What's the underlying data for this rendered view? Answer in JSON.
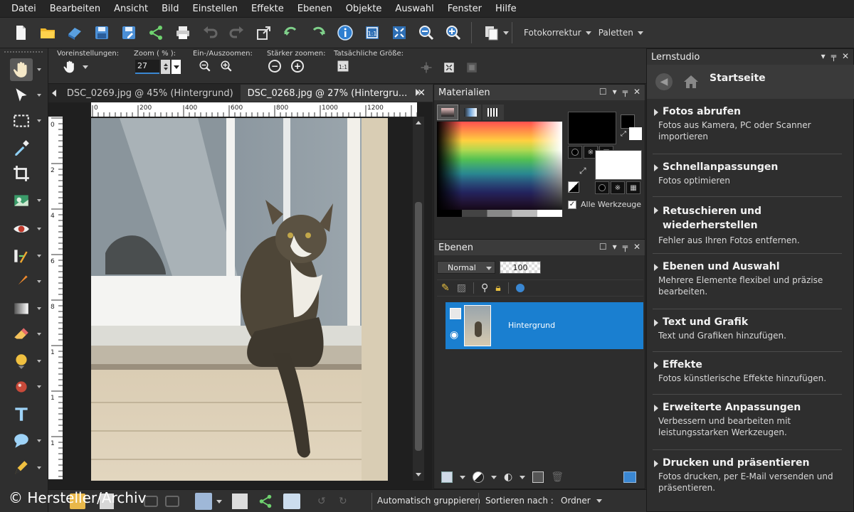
{
  "menubar": {
    "items": [
      "Datei",
      "Bearbeiten",
      "Ansicht",
      "Bild",
      "Einstellen",
      "Effekte",
      "Ebenen",
      "Objekte",
      "Auswahl",
      "Fenster",
      "Hilfe"
    ]
  },
  "toolbar": {
    "fotokorrektur_label": "Fotokorrektur",
    "paletten_label": "Paletten"
  },
  "tool_options": {
    "presets_label": "Voreinstellungen:",
    "zoom_label": "Zoom ( % ):",
    "zoom_value": "27",
    "zoom_in_out_label": "Ein-/Auszoomen:",
    "zoom_more_label": "Stärker zoomen:",
    "actual_size_label": "Tatsächliche Größe:"
  },
  "documents": {
    "tabs": [
      {
        "label": "DSC_0269.jpg @  45% (Hintergrund)",
        "active": false
      },
      {
        "label": "DSC_0268.jpg @  27% (Hintergru...",
        "active": true
      }
    ],
    "ruler_ticks": [
      "0",
      "200",
      "400",
      "600",
      "800",
      "1000",
      "1200"
    ],
    "ruler_left_ticks": [
      "0",
      "2",
      "4",
      "6",
      "8",
      "1",
      "1",
      "1"
    ]
  },
  "materials": {
    "title": "Materialien",
    "all_tools_label": "Alle Werkzeuge"
  },
  "layers": {
    "title": "Ebenen",
    "blend_mode": "Normal",
    "opacity": "100",
    "layer_name": "Hintergrund"
  },
  "learning": {
    "title": "Lernstudio",
    "home_label": "Startseite",
    "sections": [
      {
        "title": "Fotos abrufen",
        "desc": "Fotos aus Kamera, PC oder Scanner importieren"
      },
      {
        "title": "Schnellanpassungen",
        "desc": "Fotos optimieren"
      },
      {
        "title": "Retuschieren und wiederherstellen",
        "desc": "Fehler aus Ihren Fotos entfernen."
      },
      {
        "title": "Ebenen und Auswahl",
        "desc": "Mehrere Elemente flexibel und präzise bearbeiten."
      },
      {
        "title": "Text und Grafik",
        "desc": "Text und Grafiken hinzufügen."
      },
      {
        "title": "Effekte",
        "desc": "Fotos künstlerische Effekte hinzufügen."
      },
      {
        "title": "Erweiterte Anpassungen",
        "desc": "Verbessern und bearbeiten mit leistungsstarken Werkzeugen."
      },
      {
        "title": "Drucken und präsentieren",
        "desc": "Fotos drucken, per E-Mail versenden und präsentieren."
      }
    ]
  },
  "bottombar": {
    "auto_group_label": "Automatisch gruppieren",
    "sort_label": "Sortieren nach :",
    "sort_value": "Ordner"
  },
  "credit": "© Hersteller/Archiv",
  "colors": {
    "selection_blue": "#1a7fd0",
    "panel_bg": "#2d2d2d"
  }
}
